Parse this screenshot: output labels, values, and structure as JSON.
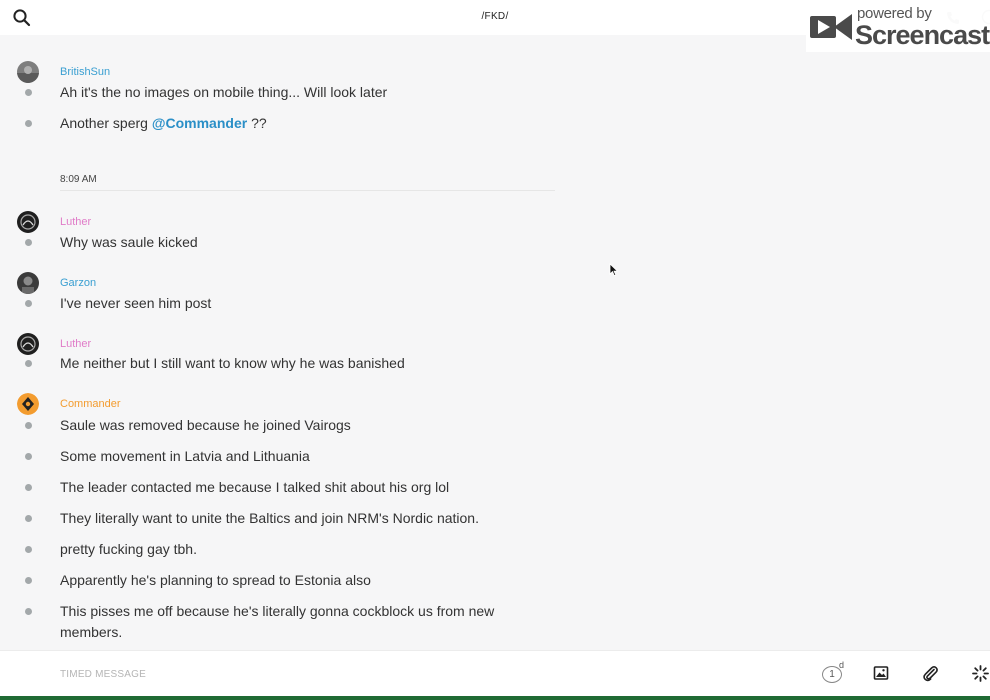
{
  "header": {
    "channel_title": "/FKD/",
    "watermark_small": "powered by",
    "watermark_big": "Screencastify",
    "icons": [
      "search-icon",
      "phone-icon",
      "info-icon"
    ]
  },
  "chat": {
    "top_ghost": "· · ·",
    "time_separator": "8:09 AM",
    "posts": [
      {
        "user": "BritishSun",
        "user_color": "#3a9fd1",
        "messages": [
          {
            "text": "Ah it's the no images on mobile thing... Will look later"
          },
          {
            "prefix": "Another sperg ",
            "mention": "@Commander",
            "suffix": " ??"
          }
        ]
      },
      {
        "user": "Luther",
        "user_color": "#e07cc8",
        "messages": [
          {
            "text": "Why was saule kicked"
          }
        ]
      },
      {
        "user": "Garzon",
        "user_color": "#3a9fd1",
        "messages": [
          {
            "text": "I've never seen him post"
          }
        ]
      },
      {
        "user": "Luther",
        "user_color": "#e07cc8",
        "messages": [
          {
            "text": "Me neither but I still want to know why he was banished"
          }
        ]
      },
      {
        "user": "Commander",
        "user_color": "#f39c2f",
        "messages": [
          {
            "text": "Saule was removed because he joined Vairogs"
          },
          {
            "text": "Some movement in Latvia and Lithuania"
          },
          {
            "text": "The leader contacted me because I talked shit about his org lol"
          },
          {
            "text": "They literally want to unite the Baltics and join NRM's Nordic nation."
          },
          {
            "text": "pretty fucking gay tbh."
          },
          {
            "text": "Apparently he's planning to spread to Estonia also"
          },
          {
            "text": "This pisses me off because he's literally gonna cockblock us from new members."
          }
        ]
      }
    ]
  },
  "composer": {
    "placeholder": "TIMED MESSAGE",
    "timer_value": "1",
    "timer_unit": "d",
    "icons": [
      "timer-icon",
      "image-icon",
      "paperclip-icon",
      "loading-icon"
    ]
  }
}
